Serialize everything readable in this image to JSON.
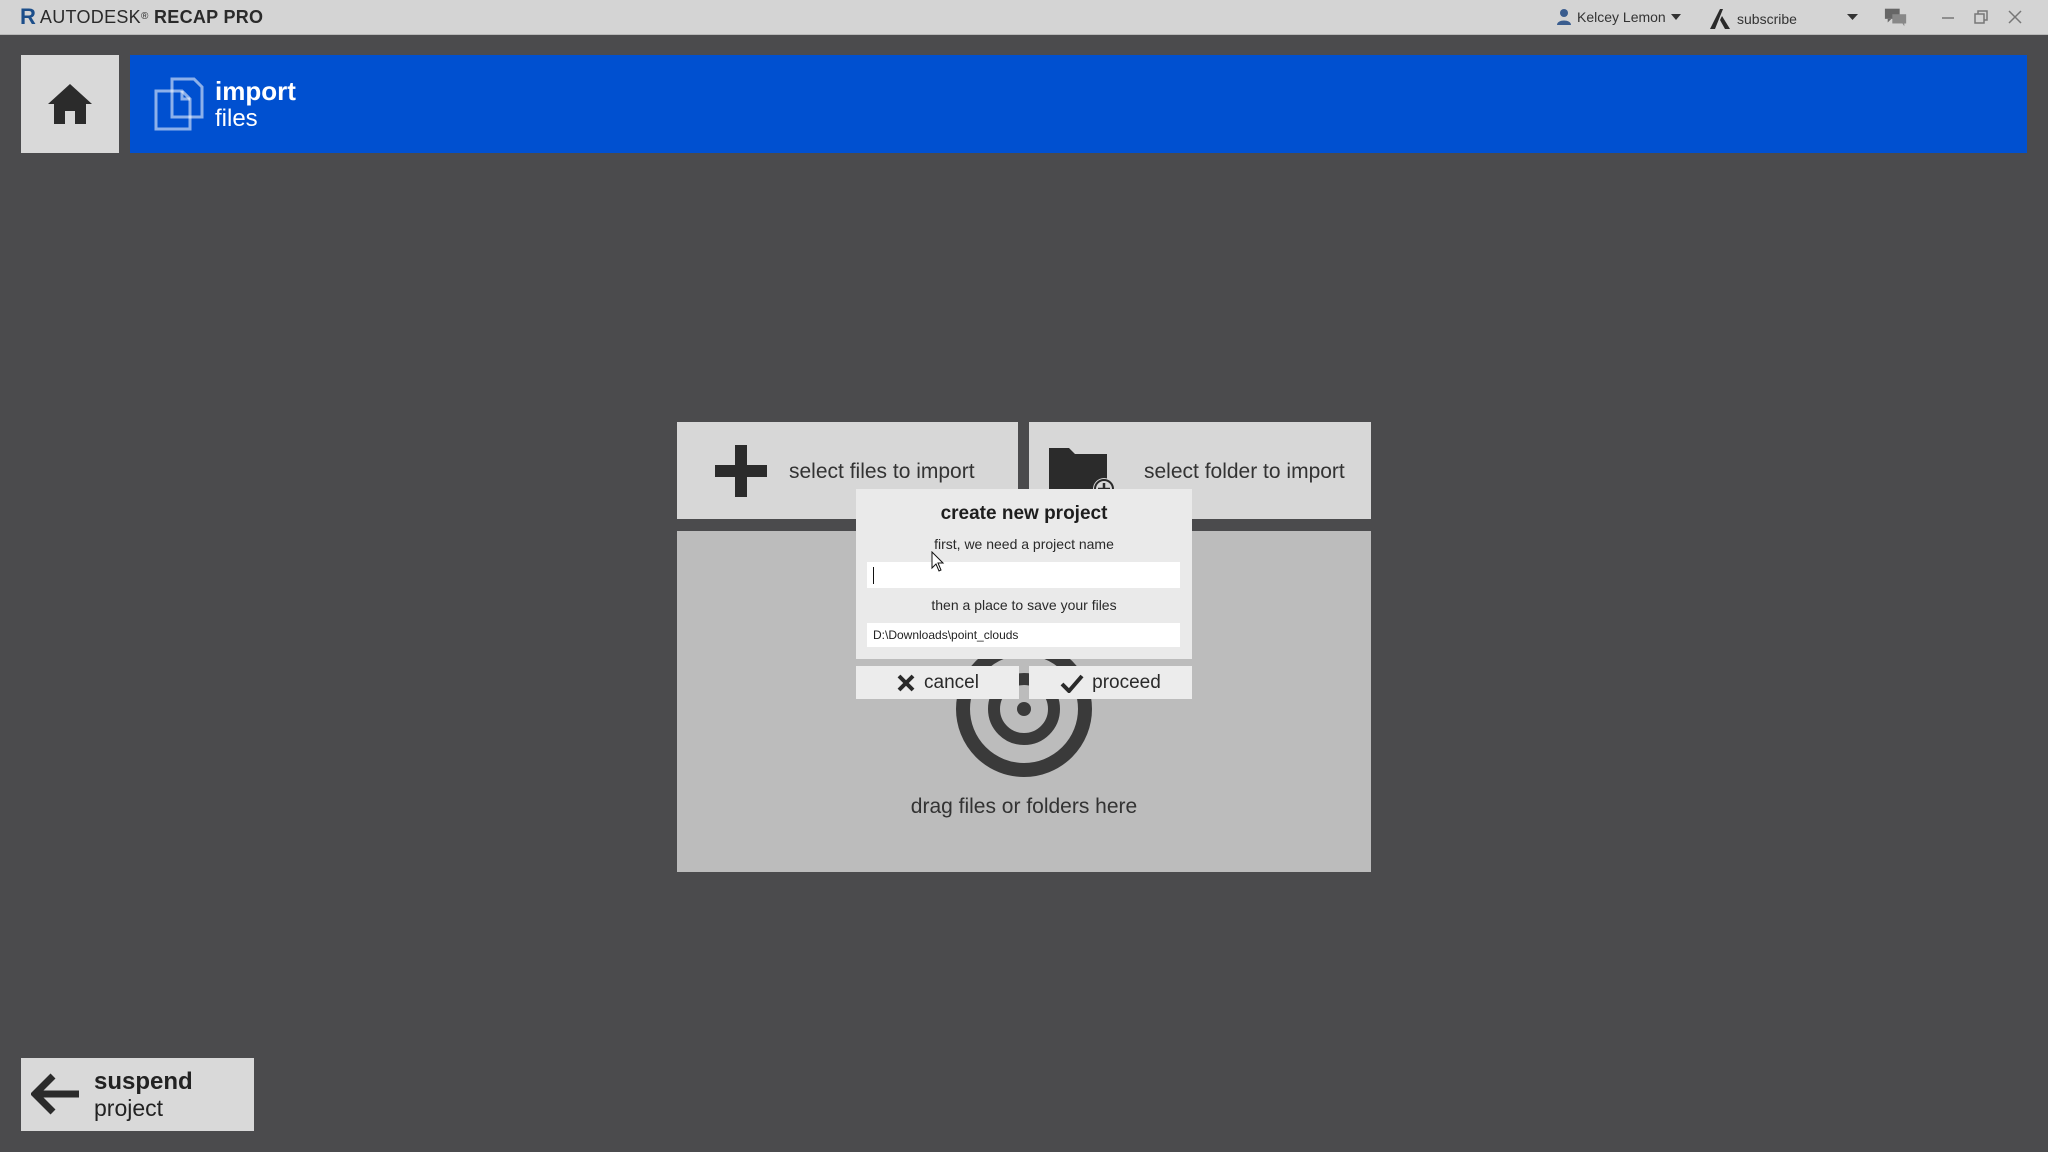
{
  "app": {
    "brand_prefix": "AUTODESK",
    "brand_suffix": "RECAP PRO",
    "brand_mark": "R"
  },
  "titlebar": {
    "user_name": "Kelcey Lemon",
    "subscribe_label": "subscribe"
  },
  "header": {
    "title": "import",
    "subtitle": "files"
  },
  "import_panel": {
    "select_files_label": "select files to import",
    "select_folder_label": "select folder to import",
    "drop_label": "drag files or folders here"
  },
  "dialog": {
    "title": "create new project",
    "name_prompt": "first, we need a project name",
    "name_value": "",
    "path_prompt": "then a place to save your files",
    "path_value": "D:\\Downloads\\point_clouds",
    "cancel_label": "cancel",
    "proceed_label": "proceed"
  },
  "suspend": {
    "title": "suspend",
    "subtitle": "project"
  },
  "colors": {
    "header_blue": "#0050d0",
    "background": "#4b4b4d",
    "tile": "#d7d7d7",
    "drop_zone": "#bcbcbc"
  }
}
